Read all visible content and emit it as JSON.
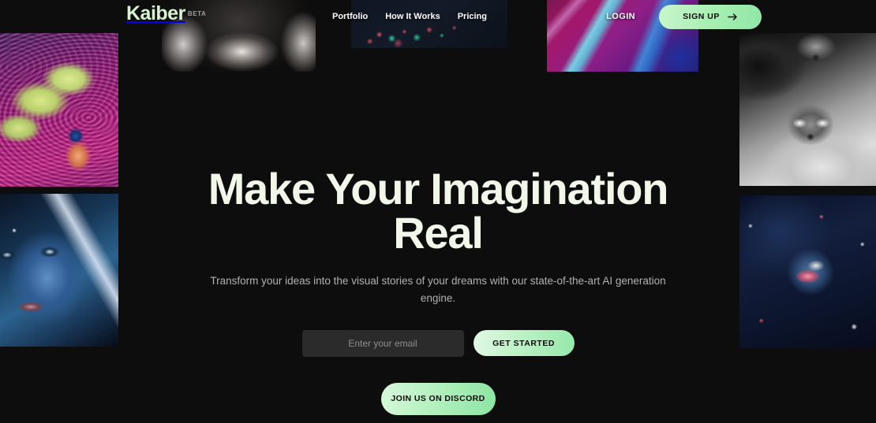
{
  "brand": {
    "name": "Kaiber",
    "badge": "BETA",
    "logo_color": "#d8f3d0"
  },
  "nav": {
    "links": [
      {
        "label": "Portfolio"
      },
      {
        "label": "How It Works"
      },
      {
        "label": "Pricing"
      }
    ],
    "login_label": "LOGIN",
    "signup_label": "SIGN UP",
    "signup_icon": "arrow-right-icon"
  },
  "hero": {
    "title": "Make Your Imagination Real",
    "subtitle": "Transform your ideas into the visual stories of your dreams with our state-of-the-art AI generation engine.",
    "email_placeholder": "Enter your email",
    "email_value": "",
    "get_started_label": "GET STARTED",
    "discord_label": "JOIN US ON DISCORD"
  },
  "theme": {
    "background": "#0d0d0d",
    "accent_green": "#a9efb4",
    "accent_green_light": "#e2f8e4",
    "heading_color": "#f1f7e9",
    "body_text": "#b2b2b2"
  },
  "artwork": [
    {
      "name": "bw-portrait-lips",
      "description": "Black and white close-up portrait with jewelry"
    },
    {
      "name": "dark-bokeh-particles",
      "description": "Dark scene with red and teal bokeh particles"
    },
    {
      "name": "magenta-cyan-ribbons",
      "description": "Magenta and cyan flowing ribbon abstract"
    },
    {
      "name": "psychedelic-astronaut",
      "description": "Astronaut among green clouds and pink swirls"
    },
    {
      "name": "blue-portrait-face",
      "description": "Blue-lit portrait of a woman's face"
    },
    {
      "name": "monochrome-fox-smoke",
      "description": "Monochrome fox emerging from smoke"
    },
    {
      "name": "dark-cosmic-scene",
      "description": "Dark blue cosmic scene with colorful particles"
    }
  ]
}
